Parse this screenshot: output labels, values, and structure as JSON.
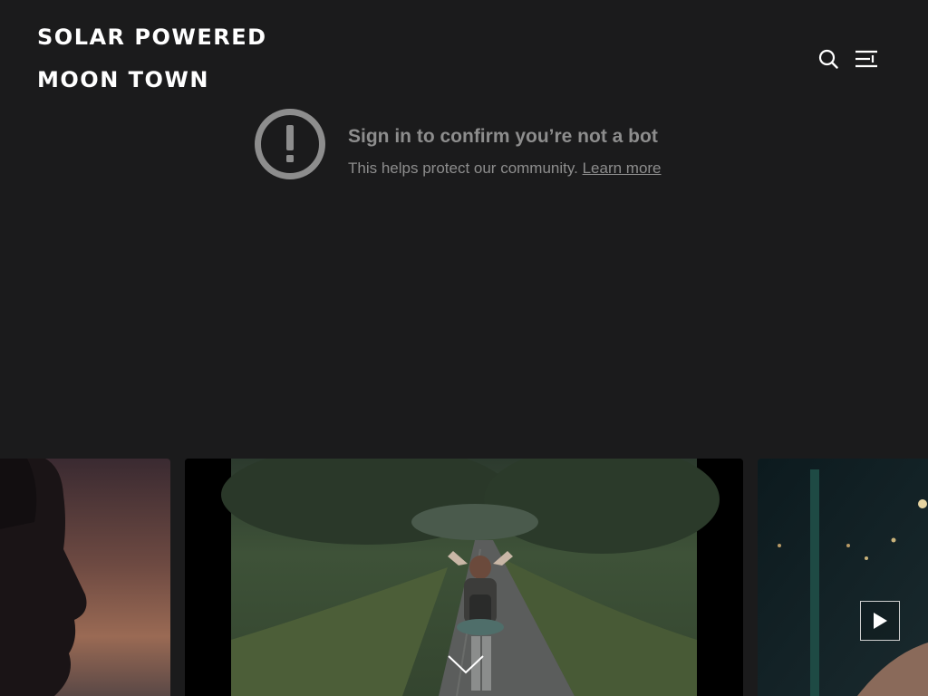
{
  "site": {
    "title_line1": "SOLAR POWERED",
    "title_line2": "MOON TOWN"
  },
  "header": {
    "search_icon": "search-icon",
    "menu_icon": "menu-toggle-icon"
  },
  "video": {
    "warning_title": "Sign in to confirm you’re not a bot",
    "warning_text": "This helps protect our community.",
    "learn_more": "Learn more",
    "warning_icon": "exclamation-circle-icon"
  },
  "gallery": {
    "slides": [
      {
        "name": "sunset-portrait"
      },
      {
        "name": "hiker-on-road"
      },
      {
        "name": "night-scene"
      }
    ],
    "play_icon": "play-icon",
    "scroll_icon": "chevron-down-icon"
  },
  "colors": {
    "background": "#1b1b1c",
    "header_text": "#ffffff",
    "warning_text": "#8d8d8d"
  }
}
